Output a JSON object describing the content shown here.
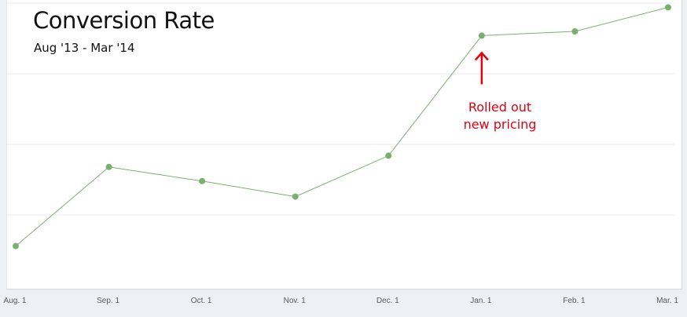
{
  "chart_data": {
    "type": "line",
    "title": "Conversion Rate",
    "subtitle": "Aug '13 - Mar '14",
    "categories": [
      "Aug. 1",
      "Sep. 1",
      "Oct. 1",
      "Nov. 1",
      "Dec. 1",
      "Jan. 1",
      "Feb. 1",
      "Mar. 1"
    ],
    "values": [
      0.14,
      0.42,
      0.37,
      0.315,
      0.46,
      0.885,
      0.9,
      0.985
    ],
    "ylim": [
      0,
      1
    ],
    "y_gridlines": [
      0.25,
      0.5,
      0.75,
      1.0
    ],
    "show_y_tick_labels": false,
    "grid": true,
    "line_color": "#7ab06f",
    "annotations": [
      {
        "category": "Jan. 1",
        "text": [
          "Rolled out",
          "new pricing"
        ],
        "color": "#e3000f"
      }
    ]
  }
}
